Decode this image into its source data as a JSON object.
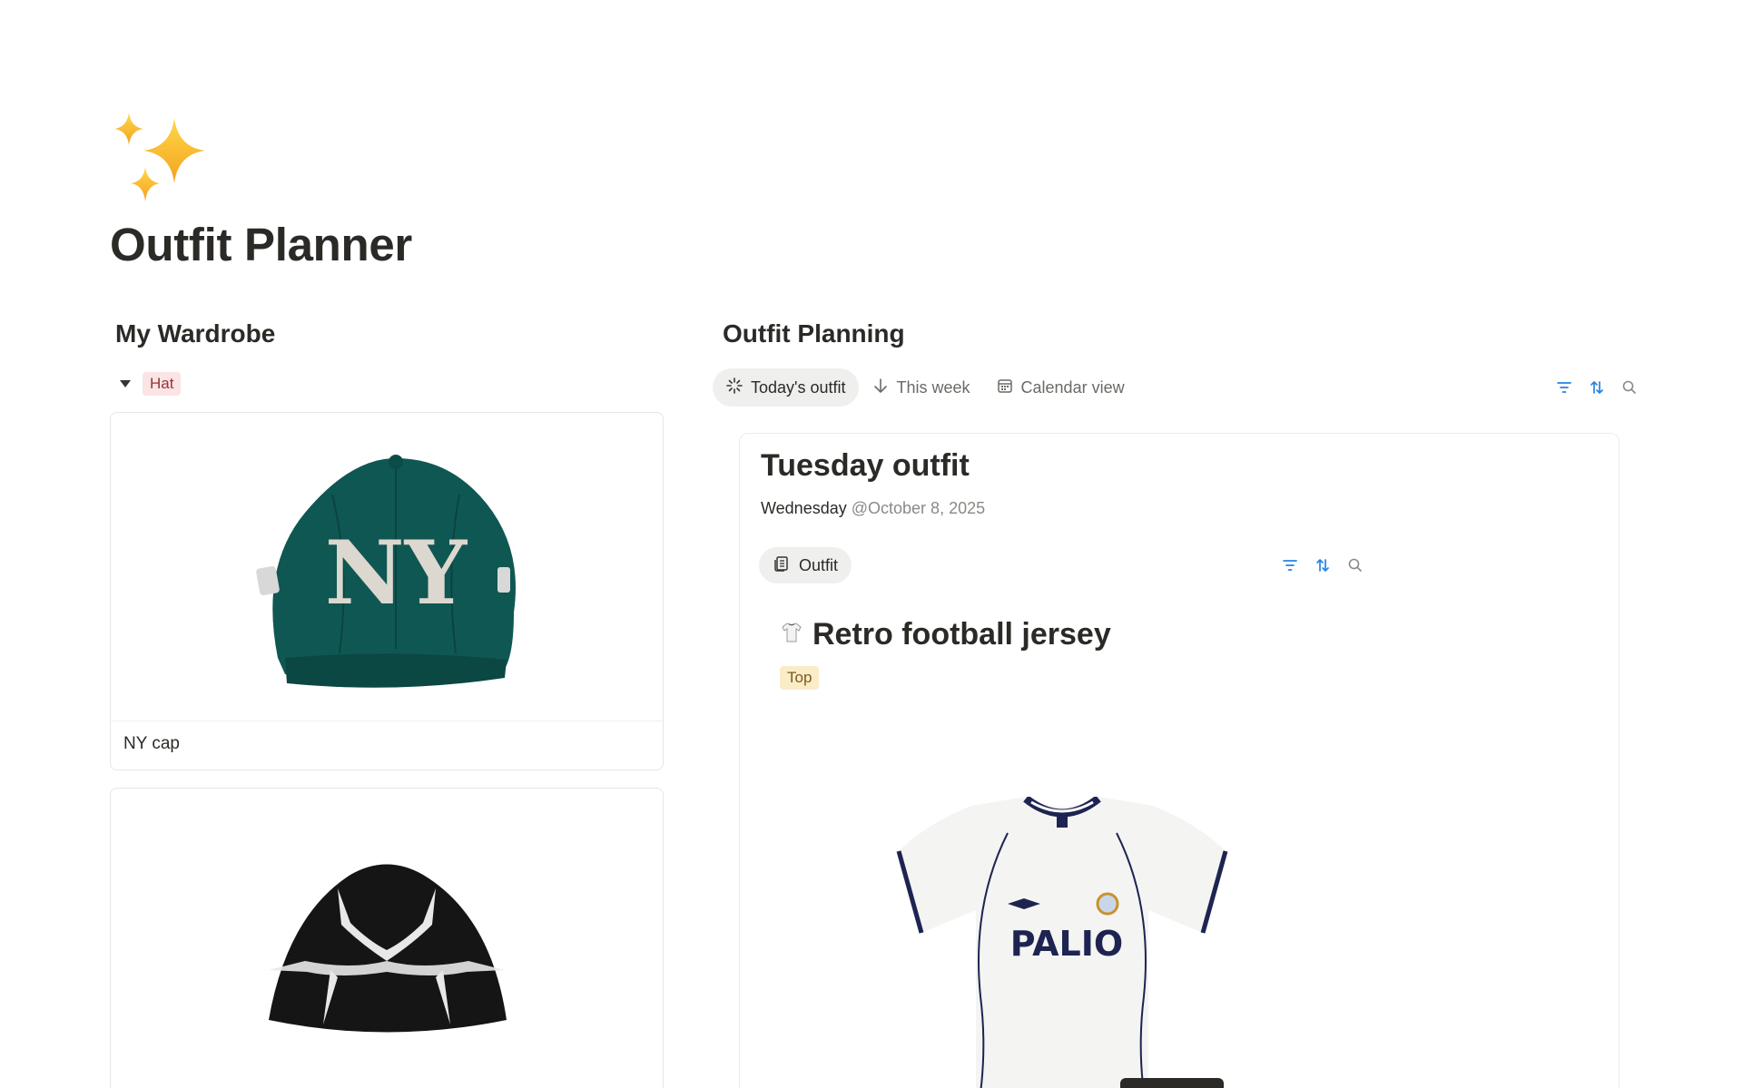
{
  "page": {
    "icon": "sparkles-icon",
    "title": "Outfit Planner"
  },
  "wardrobe": {
    "heading": "My Wardrobe",
    "group": {
      "toggle_icon": "triangle-down-icon",
      "tag": "Hat",
      "tag_color": "#fbe4e4"
    },
    "items": [
      {
        "caption": "NY cap",
        "image": "green-ny-baseball-cap"
      },
      {
        "caption": "",
        "image": "black-beanie-with-star-pattern"
      }
    ]
  },
  "planning": {
    "heading": "Outfit Planning",
    "tabs": [
      {
        "label": "Today's outfit",
        "icon": "sparkle-burst-icon",
        "active": true
      },
      {
        "label": "This week",
        "icon": "arrow-down-icon",
        "active": false
      },
      {
        "label": "Calendar view",
        "icon": "calendar-icon",
        "active": false
      }
    ],
    "tools": [
      "filter-icon",
      "sort-icon",
      "search-icon"
    ],
    "card": {
      "title": "Tuesday outfit",
      "day": "Wednesday",
      "date_mention": "@October 8, 2025",
      "inner_tab": {
        "label": "Outfit",
        "icon": "document-stack-icon"
      },
      "item": {
        "icon": "tshirt-icon",
        "title": "Retro football jersey",
        "tag": "Top",
        "tag_color": "#fbecc8",
        "image": "white-palio-football-jersey",
        "jersey_text": "PALIO"
      }
    }
  },
  "colors": {
    "accent_blue": "#2383e2",
    "text": "#2b2a26",
    "muted": "#8a8984"
  }
}
